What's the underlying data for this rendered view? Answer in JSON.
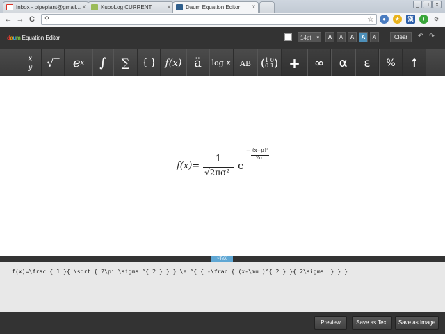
{
  "browser": {
    "tabs": [
      {
        "label": "Inbox - pipeplant@gmail...",
        "favicon": "gmail-icon",
        "color": "#d93025"
      },
      {
        "label": "KuboLog CURRENT",
        "favicon": "kubolog-icon",
        "color": "#6b8e23"
      },
      {
        "label": "Daum Equation Editor",
        "favicon": "daum-icon",
        "color": "#2f5e8c"
      }
    ],
    "tab_close": "x",
    "url": "",
    "nav": {
      "back": "←",
      "forward": "→",
      "reload": "C"
    },
    "window_controls": {
      "minimize": "_",
      "maximize": "□",
      "close": "x"
    },
    "extensions": [
      "translate-icon",
      "bookmark-star-icon",
      "chinese-ext-icon",
      "add-icon",
      "wrench-icon"
    ],
    "ext_glyphs": [
      "●",
      "★",
      "漢",
      "+",
      "⚙"
    ]
  },
  "editor": {
    "logo_daum": [
      "d",
      "a",
      "u",
      "m"
    ],
    "logo_text": "Equation Editor",
    "font_size": "14pt",
    "format_buttons": [
      "A",
      "A",
      "A",
      "A",
      "A"
    ],
    "clear_label": "Clear",
    "undo": "↶",
    "redo": "↷"
  },
  "symbols": [
    {
      "name": "fraction-button",
      "glyph": "x/y"
    },
    {
      "name": "sqrt-button",
      "glyph": "√‾"
    },
    {
      "name": "exponent-button",
      "glyph": "eˣ"
    },
    {
      "name": "integral-button",
      "glyph": "∫"
    },
    {
      "name": "sum-button",
      "glyph": "∑"
    },
    {
      "name": "braces-button",
      "glyph": "{ }"
    },
    {
      "name": "function-button",
      "glyph": "f(x)"
    },
    {
      "name": "accent-button",
      "glyph": "ä"
    },
    {
      "name": "log-button",
      "glyph": "log x"
    },
    {
      "name": "overline-button",
      "glyph": "AB"
    },
    {
      "name": "matrix-button",
      "glyph": "(1 0 / 0 1)"
    },
    {
      "name": "operators-button",
      "glyph": "+"
    },
    {
      "name": "infinity-button",
      "glyph": "∞"
    },
    {
      "name": "greek-button",
      "glyph": "α"
    },
    {
      "name": "epsilon-button",
      "glyph": "ε"
    },
    {
      "name": "percent-button",
      "glyph": "%"
    },
    {
      "name": "arrow-button",
      "glyph": "↑"
    }
  ],
  "formula": {
    "lhs": "f(x)=",
    "numerator": "1",
    "denominator": "√2πσ²",
    "base": "e",
    "exponent_num": "(x−μ)²",
    "exponent_den": "2σ",
    "exponent_sign": "−"
  },
  "tex_toggle": "~TeX",
  "tex_source": "f(x)=\\frac { 1 }{ \\sqrt { 2\\pi \\sigma ^{ 2 } } } \\e ^{ { -\\frac { (x-\\mu )^{ 2 } }{ 2\\sigma  } } }",
  "actions": {
    "preview": "Preview",
    "save_text": "Save as Text",
    "save_image": "Save as Image"
  }
}
